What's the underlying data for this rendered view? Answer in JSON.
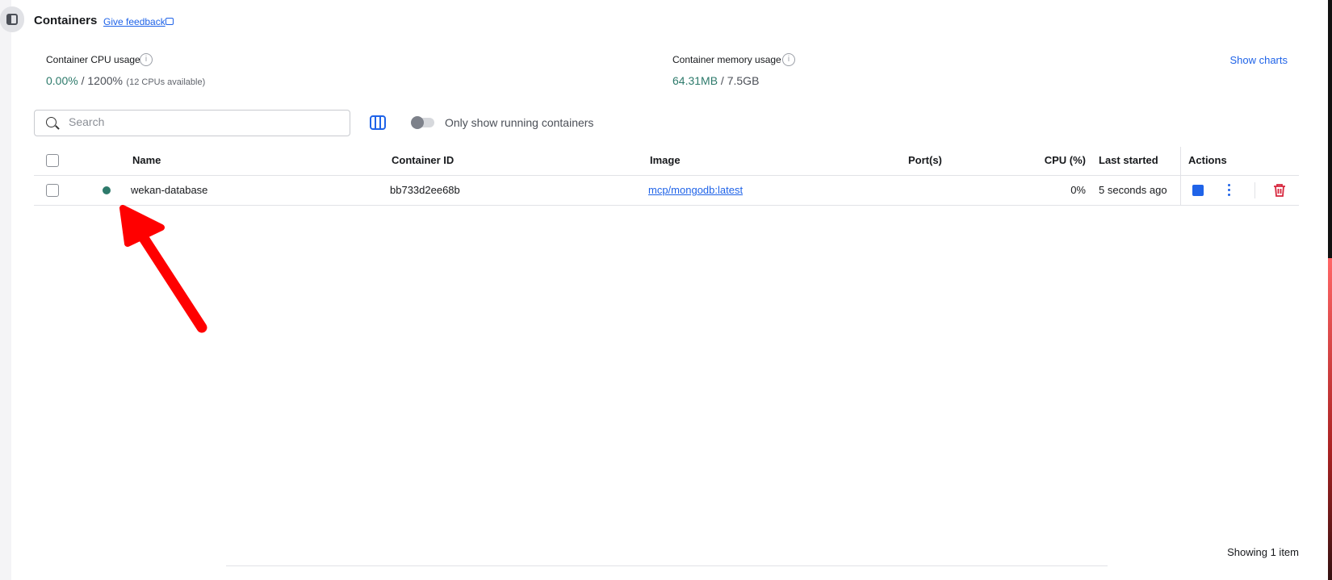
{
  "header": {
    "title": "Containers",
    "feedback_link": "Give feedback",
    "show_charts": "Show charts"
  },
  "stats": {
    "cpu": {
      "label": "Container CPU usage",
      "value": "0.00%",
      "total": " / 1200%",
      "note": "(12 CPUs available)"
    },
    "memory": {
      "label": "Container memory usage",
      "value": "64.31MB",
      "total": " / 7.5GB"
    }
  },
  "toolbar": {
    "search_placeholder": "Search",
    "search_value": "",
    "running_toggle_label": "Only show running containers",
    "running_toggle_on": false
  },
  "table": {
    "columns": [
      "Name",
      "Container ID",
      "Image",
      "Port(s)",
      "CPU (%)",
      "Last started",
      "Actions"
    ],
    "rows": [
      {
        "status": "running",
        "name": "wekan-database",
        "container_id": "bb733d2ee68b",
        "image": "mcp/mongodb:latest",
        "ports": "",
        "cpu": "0%",
        "last_started": "5 seconds ago"
      }
    ],
    "footer": "Showing 1 item"
  },
  "colors": {
    "accent": "#1f63e8",
    "running": "#2d7a6b",
    "danger": "#d7263d",
    "annotation_arrow": "#ff0000"
  }
}
